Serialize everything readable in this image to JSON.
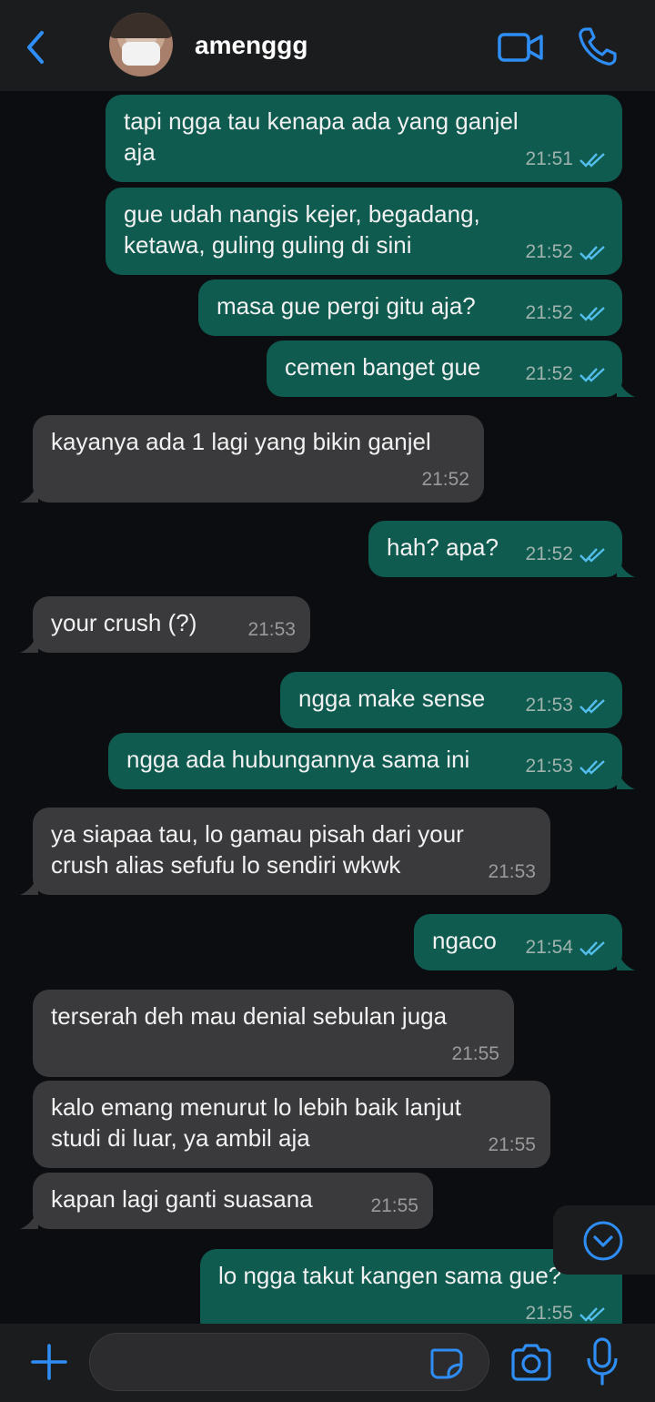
{
  "header": {
    "contact_name": "amenggg",
    "back_icon": "chevron-left-icon",
    "video_icon": "video-camera-icon",
    "call_icon": "phone-icon",
    "accent_color": "#2f8ef5"
  },
  "messages": [
    {
      "dir": "out",
      "text": "tapi ngga tau kenapa ada yang ganjel\naja",
      "time": "21:51",
      "read": true
    },
    {
      "dir": "out",
      "text": "gue udah nangis kejer, begadang,\nketawa, guling guling di sini",
      "time": "21:52",
      "read": true
    },
    {
      "dir": "out",
      "text": "masa gue pergi gitu aja?",
      "time": "21:52",
      "read": true
    },
    {
      "dir": "out",
      "text": "cemen banget gue",
      "time": "21:52",
      "read": true
    },
    {
      "dir": "in",
      "text": "kayanya ada 1 lagi yang bikin ganjel",
      "time": "21:52"
    },
    {
      "dir": "out",
      "text": "hah? apa?",
      "time": "21:52",
      "read": true
    },
    {
      "dir": "in",
      "text": "your crush (?)",
      "time": "21:53"
    },
    {
      "dir": "out",
      "text": "ngga make sense",
      "time": "21:53",
      "read": true
    },
    {
      "dir": "out",
      "text": "ngga ada hubungannya sama ini",
      "time": "21:53",
      "read": true
    },
    {
      "dir": "in",
      "text": "ya siapaa tau, lo gamau pisah dari your\ncrush alias sefufu lo sendiri wkwk",
      "time": "21:53"
    },
    {
      "dir": "out",
      "text": "ngaco",
      "time": "21:54",
      "read": true
    },
    {
      "dir": "in",
      "text": "terserah deh mau denial sebulan juga",
      "time": "21:55"
    },
    {
      "dir": "in",
      "text": "kalo emang menurut lo lebih baik lanjut\nstudi di luar, ya ambil aja",
      "time": "21:55"
    },
    {
      "dir": "in",
      "text": "kapan lagi ganti suasana",
      "time": "21:55"
    },
    {
      "dir": "out",
      "text": "lo ngga takut kangen sama gue?",
      "time": "21:55",
      "read": true
    }
  ],
  "footer": {
    "message_input_value": "",
    "plus_icon": "plus-icon",
    "sticker_icon": "sticker-icon",
    "camera_icon": "camera-icon",
    "mic_icon": "microphone-icon"
  },
  "scroll_down_icon": "chevron-down-circle-icon"
}
